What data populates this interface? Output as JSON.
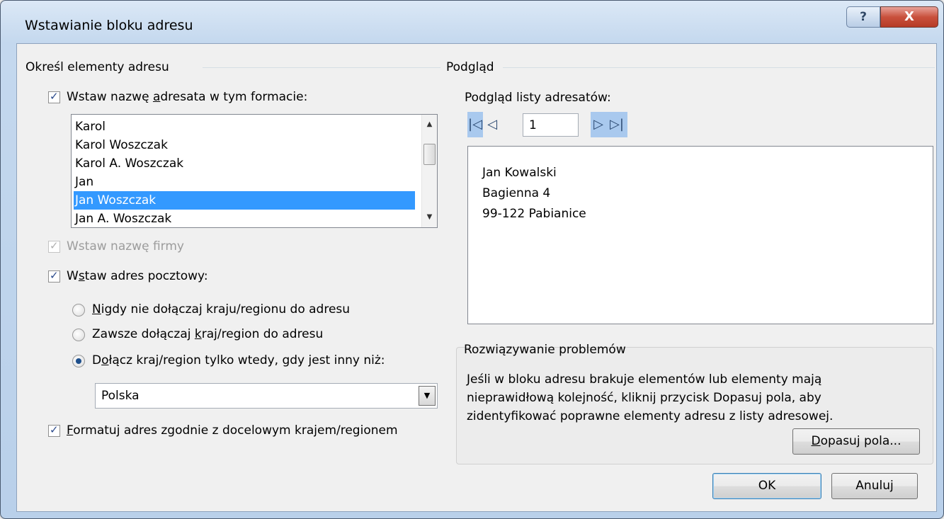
{
  "window": {
    "title": "Wstawianie bloku adresu",
    "help_glyph": "?",
    "close_glyph": "X"
  },
  "left_group": {
    "label": "Określ elementy adresu",
    "insert_name_checkbox": {
      "checked": true,
      "pre": "Wstaw nazwę ",
      "u": "a",
      "post": "dresata w tym formacie:"
    },
    "name_formats": [
      {
        "text": "Karol",
        "selected": false
      },
      {
        "text": "Karol Woszczak",
        "selected": false
      },
      {
        "text": "Karol A. Woszczak",
        "selected": false
      },
      {
        "text": "Jan",
        "selected": false
      },
      {
        "text": "Jan Woszczak",
        "selected": true
      },
      {
        "text": "Jan A. Woszczak",
        "selected": false
      }
    ],
    "company_checkbox": {
      "checked": true,
      "disabled": true,
      "label": "Wstaw nazwę firmy"
    },
    "postal_checkbox": {
      "checked": true,
      "pre": "W",
      "u": "s",
      "post": "taw adres pocztowy:"
    },
    "radio_never": {
      "selected": false,
      "u": "N",
      "post": "igdy nie dołączaj kraju/regionu do adresu"
    },
    "radio_always": {
      "selected": false,
      "pre": "Zawsze dołączaj ",
      "u": "k",
      "post": "raj/region do adresu"
    },
    "radio_only_if": {
      "selected": true,
      "pre": "D",
      "u": "o",
      "post": "łącz kraj/region tylko wtedy, gdy jest inny niż:"
    },
    "country_combo": {
      "value": "Polska",
      "arrow": "▼"
    },
    "format_checkbox": {
      "checked": true,
      "u": "F",
      "post": "ormatuj adres zgodnie z docelowym krajem/regionem"
    }
  },
  "right_group": {
    "label": "Podgląd",
    "list_label": "Podgląd listy adresatów:",
    "nav": {
      "first": "|◁",
      "prev": "◁",
      "record": "1",
      "next": "▷",
      "last": "▷|"
    },
    "preview_lines": [
      "Jan Kowalski",
      "Bagienna 4",
      "99-122 Pabianice"
    ]
  },
  "troubleshoot": {
    "label": "Rozwiązywanie problemów",
    "lines": [
      "Jeśli w bloku adresu brakuje elementów lub elementy mają",
      "nieprawidłową kolejność, kliknij przycisk Dopasuj pola, aby",
      "zidentyfikować poprawne elementy adresu z listy adresowej."
    ],
    "match_button": {
      "u": "D",
      "post": "opasuj pola..."
    }
  },
  "buttons": {
    "ok": "OK",
    "cancel": "Anuluj"
  },
  "scroll_glyphs": {
    "up": "▲",
    "down": "▼"
  }
}
